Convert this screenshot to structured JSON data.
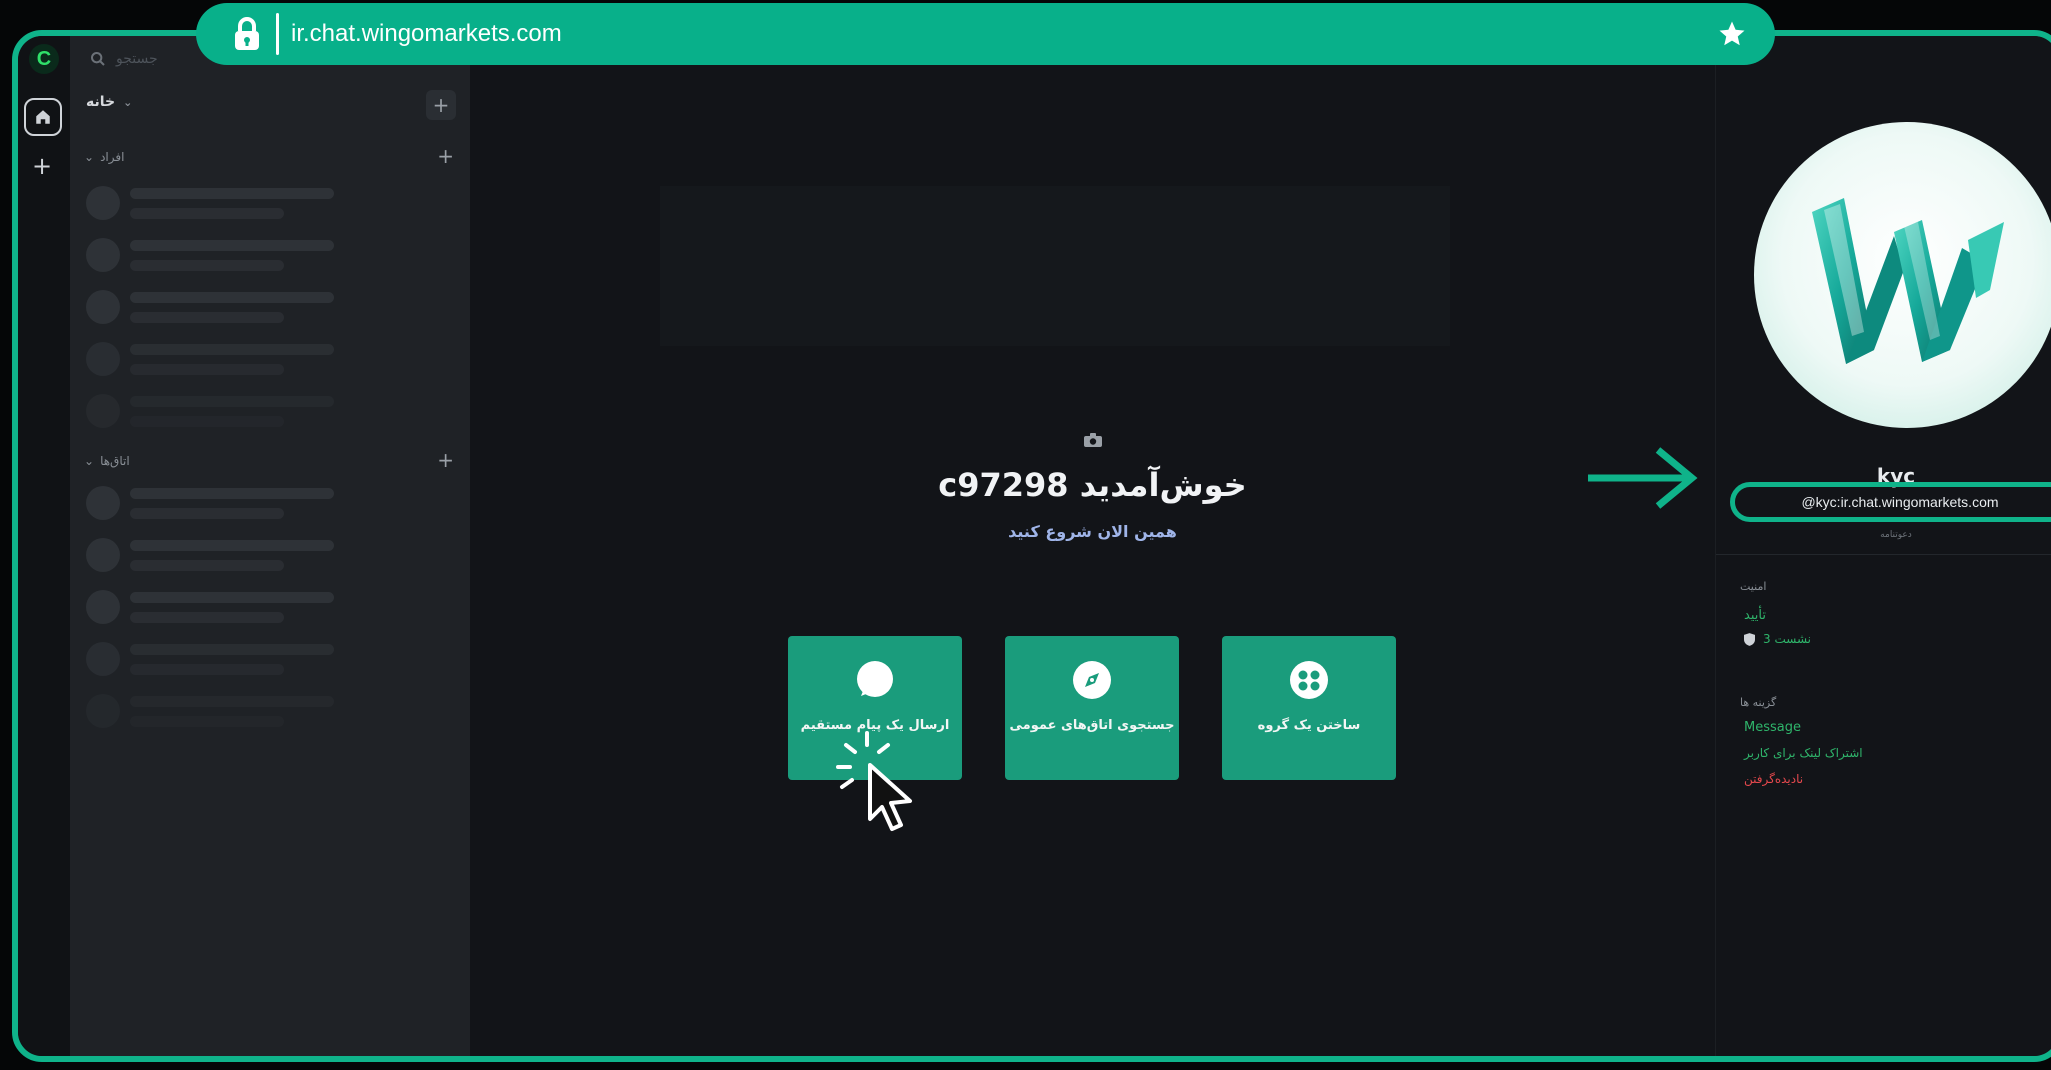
{
  "browser": {
    "url": "ir.chat.wingomarkets.com",
    "lock_icon": "lock-icon",
    "star_icon": "star-icon"
  },
  "rail": {
    "logo_letter": "C"
  },
  "sidebar": {
    "search_placeholder": "جستجو",
    "home_label": "خانه",
    "people_label": "افراد",
    "rooms_label": "اتاق‌ها"
  },
  "main": {
    "welcome": "خوش‌آمدید c97298",
    "subtitle": "همین الان شروع کنید",
    "cards": [
      {
        "label": "ارسال یک پیام مستقیم",
        "icon": "chat-bubble-icon"
      },
      {
        "label": "جستجوی اتاق‌های عمومی",
        "icon": "compass-icon"
      },
      {
        "label": "ساختن یک گروه",
        "icon": "group-icon"
      }
    ]
  },
  "profile": {
    "name": "kyc",
    "user_id": "@kyc:ir.chat.wingomarkets.com",
    "tiny_note": "دعوتنامه",
    "security_heading": "امنیت",
    "verify_label": "تأیید",
    "sessions_label": "3 نشست",
    "options_heading": "گزینه ها",
    "option_message": "Message",
    "option_share": "اشتراک لینک برای کاربر",
    "option_ignore": "نادیده‌گرفتن"
  },
  "colors": {
    "accent": "#0fb38a",
    "card": "#1a9c7c",
    "danger": "#e5484d",
    "link": "#2fb56b"
  }
}
